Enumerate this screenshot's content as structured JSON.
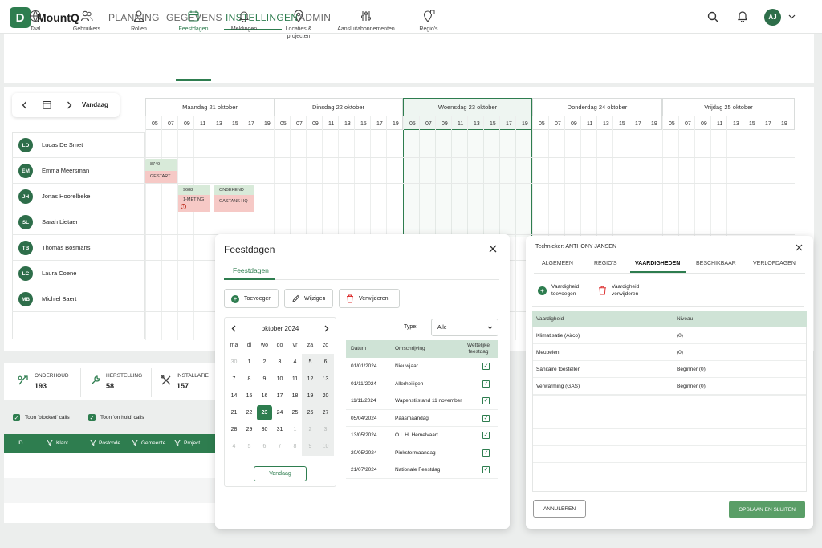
{
  "app": {
    "logo_letter": "D",
    "name": "MountQ",
    "nav": [
      "PLANNING",
      "GEGEVENS",
      "INSTELLINGEN",
      "ADMIN"
    ],
    "user_initials": "AJ"
  },
  "settings_tabs": [
    "Taal",
    "Gebruikers",
    "Rollen",
    "Feestdagen",
    "Meldingen",
    "Locaties &\nprojecten",
    "Aansluitabonnementen",
    "Regio's"
  ],
  "planner": {
    "today_label": "Vandaag",
    "days": [
      "Maandag 21 oktober",
      "Dinsdag 22 oktober",
      "Woensdag 23 oktober",
      "Donderdag 24 oktober",
      "Vrijdag 25 oktober"
    ],
    "hours": [
      "05",
      "07",
      "09",
      "11",
      "13",
      "15",
      "17",
      "19"
    ],
    "technicians": [
      {
        "initials": "LD",
        "name": "Lucas De Smet"
      },
      {
        "initials": "EM",
        "name": "Emma Meersman"
      },
      {
        "initials": "JH",
        "name": "Jonas Hoorelbeke"
      },
      {
        "initials": "SL",
        "name": "Sarah Lietaer"
      },
      {
        "initials": "TB",
        "name": "Thomas Bosmans"
      },
      {
        "initials": "LC",
        "name": "Laura Coene"
      },
      {
        "initials": "MB",
        "name": "Michiel Baert"
      }
    ],
    "jobs": [
      {
        "top": "8749",
        "bottom": "GESTART"
      },
      {
        "top": "9688",
        "bottom": "1-METING"
      },
      {
        "top": "ONBEKEND",
        "bottom": "GASTANK HQ"
      }
    ]
  },
  "stats": [
    {
      "label": "ONDERHOUD",
      "value": "193"
    },
    {
      "label": "HERSTELLING",
      "value": "58"
    },
    {
      "label": "INSTALLATIE",
      "value": "157"
    }
  ],
  "filters": [
    "Toon 'blocked' calls",
    "Toon 'on hold' calls"
  ],
  "calls_table": {
    "columns": [
      "ID",
      "Klant",
      "Postcode",
      "Gemeente",
      "Project"
    ]
  },
  "holidays": {
    "title": "Feestdagen",
    "tab": "Feestdagen",
    "buttons": {
      "add": "Toevoegen",
      "edit": "Wijzigen",
      "delete": "Verwijderen"
    },
    "calendar": {
      "month": "oktober 2024",
      "weekdays": [
        "ma",
        "di",
        "wo",
        "do",
        "vr",
        "za",
        "zo"
      ],
      "weeks": [
        [
          "30",
          "1",
          "2",
          "3",
          "4",
          "5",
          "6"
        ],
        [
          "7",
          "8",
          "9",
          "10",
          "11",
          "12",
          "13"
        ],
        [
          "14",
          "15",
          "16",
          "17",
          "18",
          "19",
          "20"
        ],
        [
          "21",
          "22",
          "23",
          "24",
          "25",
          "26",
          "27"
        ],
        [
          "28",
          "29",
          "30",
          "31",
          "1",
          "2",
          "3"
        ],
        [
          "4",
          "5",
          "6",
          "7",
          "8",
          "9",
          "10"
        ]
      ],
      "selected": "23",
      "today_button": "Vandaag"
    },
    "type_label": "Type:",
    "type_value": "Alle",
    "columns": [
      "Datum",
      "Omschrijving",
      "Wettelijke\nfeestdag"
    ],
    "rows": [
      {
        "date": "01/01/2024",
        "desc": "Nieuwjaar"
      },
      {
        "date": "01/11/2024",
        "desc": "Allerheiligen"
      },
      {
        "date": "11/11/2024",
        "desc": "Wapenstilstand 11 november"
      },
      {
        "date": "05/04/2024",
        "desc": "Paasmaandag"
      },
      {
        "date": "13/05/2024",
        "desc": "O.L.H. Hemelvaart"
      },
      {
        "date": "20/05/2024",
        "desc": "Pinkstermaandag"
      },
      {
        "date": "21/07/2024",
        "desc": "Nationale Feestdag"
      }
    ]
  },
  "technician": {
    "title": "Technieker: ANTHONY JANSEN",
    "tabs": [
      "ALGEMEEN",
      "REGIO'S",
      "VAARDIGHEDEN",
      "BESCHIKBAAR",
      "VERLOFDAGEN"
    ],
    "actions": {
      "add": "Vaardigheid\ntoevoegen",
      "delete": "Vaardigheid\nverwijderen"
    },
    "columns": [
      "Vaardigheid",
      "Niveau"
    ],
    "rows": [
      {
        "skill": "Klimatisatie (Airco)",
        "level": "(0)"
      },
      {
        "skill": "Meubelen",
        "level": "(0)"
      },
      {
        "skill": "Sanitaire toestellen",
        "level": "Beginner (0)"
      },
      {
        "skill": "Verwarming (GAS)",
        "level": "Beginner (0)"
      }
    ],
    "cancel": "ANNULEREN",
    "save": "OPSLAAN EN SLUITEN"
  },
  "colors": {
    "brand": "#2e7d4f",
    "accent_light": "#cfe3d6",
    "job_green": "#d8ead9",
    "job_red": "#f6c9c6"
  }
}
